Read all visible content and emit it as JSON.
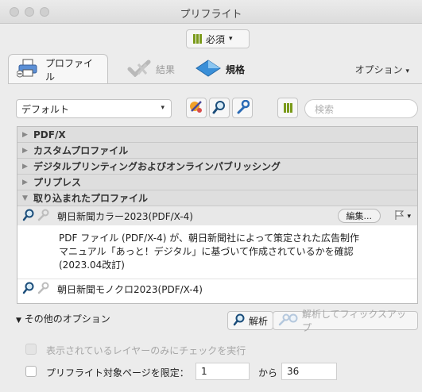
{
  "window": {
    "title": "プリフライト"
  },
  "required_dropdown": {
    "label": "必須"
  },
  "tabs": [
    {
      "label": "プロファイル",
      "icon": "printer-icon",
      "active": true
    },
    {
      "label": "結果",
      "icon": "check-icon",
      "active": false
    },
    {
      "label": "規格",
      "icon": "diamond-icon",
      "active": false
    }
  ],
  "options_menu": {
    "label": "オプション"
  },
  "toolbar": {
    "profile_select": "デフォルト",
    "search_placeholder": "検索"
  },
  "categories": [
    {
      "label": "PDF/X",
      "expanded": false
    },
    {
      "label": "カスタムプロファイル",
      "expanded": false
    },
    {
      "label": "デジタルプリンティングおよびオンラインパブリッシング",
      "expanded": false
    },
    {
      "label": "プリプレス",
      "expanded": false
    },
    {
      "label": "取り込まれたプロファイル",
      "expanded": true
    }
  ],
  "profiles": [
    {
      "name": "朝日新聞カラー2023(PDF/X-4)",
      "selected": true,
      "edit_label": "編集...",
      "description_lines": [
        "PDF ファイル (PDF/X-4) が、朝日新聞社によって策定された広告制作",
        "マニュアル「あっと！デジタル」に基づいて作成されているかを確認",
        "(2023.04改訂)"
      ]
    },
    {
      "name": "朝日新聞モノクロ2023(PDF/X-4)",
      "selected": false
    }
  ],
  "bottom": {
    "more_options": "その他のオプション",
    "analyze": "解析",
    "analyze_fix": "解析してフィックスアップ",
    "visible_layers_only": "表示されているレイヤーのみにチェックを実行",
    "limit_pages": "プリフライト対象ページを限定：",
    "page_from": "1",
    "to_label": "から",
    "page_to": "36"
  },
  "colors": {
    "accent_green": "#7a9a1a",
    "selected_row": "#e8e8e8",
    "category_bg": "#dedede"
  }
}
